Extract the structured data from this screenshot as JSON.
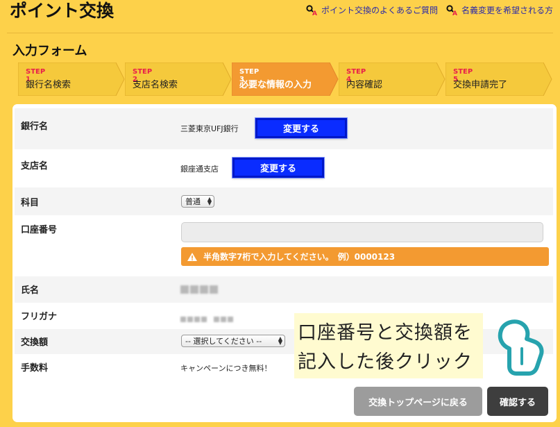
{
  "header": {
    "title": "ポイント交換",
    "links": [
      {
        "label": "ポイント交換のよくあるご質問",
        "icon": "key-search-icon"
      },
      {
        "label": "名義変更を希望される方",
        "icon": "key-search-icon"
      }
    ]
  },
  "form": {
    "title": "入力フォーム",
    "steps": [
      {
        "num": "STEP 1",
        "label": "銀行名検索",
        "active": false
      },
      {
        "num": "STEP 2",
        "label": "支店名検索",
        "active": false
      },
      {
        "num": "STEP 3",
        "label": "必要な情報の入力",
        "active": true
      },
      {
        "num": "STEP 4",
        "label": "内容確認",
        "active": false
      },
      {
        "num": "STEP 5",
        "label": "交換申請完了",
        "active": false
      }
    ],
    "rows": {
      "bank": {
        "label": "銀行名",
        "value": "三菱東京UFJ銀行",
        "button": "変更する"
      },
      "branch": {
        "label": "支店名",
        "value": "銀座通支店",
        "button": "変更する"
      },
      "account_type": {
        "label": "科目",
        "selected": "普通"
      },
      "account_number": {
        "label": "口座番号",
        "value": "",
        "warning": "半角数字7桁で入力してください。　例）0000123"
      },
      "name": {
        "label": "氏名"
      },
      "kana": {
        "label": "フリガナ"
      },
      "amount": {
        "label": "交換額",
        "selected": "-- 選択してください --"
      },
      "fee": {
        "label": "手数料",
        "value": "キャンペーンにつき無料！"
      }
    }
  },
  "annotation": {
    "line1": "口座番号と交換額を",
    "line2": "記入した後クリック",
    "icon": "pointing-hand-icon"
  },
  "buttons": {
    "back": "交換トップページに戻る",
    "confirm": "確認する"
  },
  "colors": {
    "background": "#fdd14a",
    "active_step": "#f39a31",
    "step": "#f5c93c",
    "primary_button": "#0a2cff",
    "warning": "#f39a31"
  }
}
